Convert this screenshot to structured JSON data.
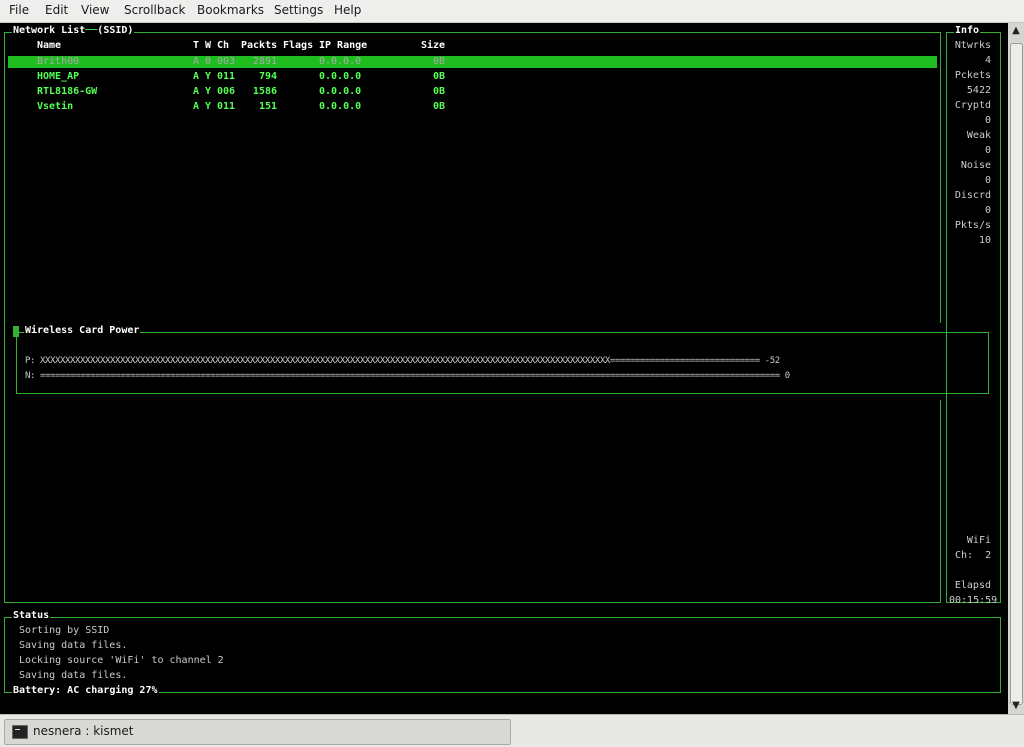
{
  "menubar": {
    "items": [
      "File",
      "Edit",
      "View",
      "Scrollback",
      "Bookmarks",
      "Settings",
      "Help"
    ]
  },
  "network_list": {
    "title": "Network List",
    "sort_label": "(SSID)",
    "headers": {
      "name": "Name",
      "type": "T",
      "wep": "W",
      "channel": "Ch",
      "packets": "Packts",
      "flags": "Flags",
      "ip_range": "IP Range",
      "size": "Size"
    },
    "rows": [
      {
        "name": "Brith00",
        "type": "A",
        "wep": "0",
        "channel": "003",
        "packets": "2891",
        "flags": "",
        "ip_range": "0.0.0.0",
        "size": "0B",
        "selected": true
      },
      {
        "name": "HOME_AP",
        "type": "A",
        "wep": "Y",
        "channel": "011",
        "packets": "794",
        "flags": "",
        "ip_range": "0.0.0.0",
        "size": "0B",
        "selected": false
      },
      {
        "name": "RTL8186-GW",
        "type": "A",
        "wep": "Y",
        "channel": "006",
        "packets": "1586",
        "flags": "",
        "ip_range": "0.0.0.0",
        "size": "0B",
        "selected": false
      },
      {
        "name": "Vsetin",
        "type": "A",
        "wep": "Y",
        "channel": "011",
        "packets": "151",
        "flags": "",
        "ip_range": "0.0.0.0",
        "size": "0B",
        "selected": false
      }
    ]
  },
  "info": {
    "title": "Info",
    "stats": [
      {
        "label": "Ntwrks",
        "value": "4"
      },
      {
        "label": "Pckets",
        "value": "5422"
      },
      {
        "label": "Cryptd",
        "value": "0"
      },
      {
        "label": "Weak",
        "value": "0"
      },
      {
        "label": "Noise",
        "value": "0"
      },
      {
        "label": "Discrd",
        "value": "0"
      },
      {
        "label": "Pkts/s",
        "value": "10"
      }
    ],
    "source_label": "WiFi",
    "channel_text": "Ch:  2",
    "elapsed_label": "Elapsd",
    "elapsed_value": "00:15:59"
  },
  "power": {
    "title": "Wireless Card Power",
    "power_line": "P: XXXXXXXXXXXXXXXXXXXXXXXXXXXXXXXXXXXXXXXXXXXXXXXXXXXXXXXXXXXXXXXXXXXXXXXXXXXXXXXXXXXXXXXXXXXXXXXXXXXXXXXXXXXXXXXXXX============================== -52",
    "noise_line": "N: ==================================================================================================================================================== 0"
  },
  "status": {
    "title": "Status",
    "lines": [
      "Sorting by SSID",
      "Saving data files.",
      "Locking source 'WiFi' to channel 2",
      "Saving data files."
    ],
    "battery": "Battery: AC charging 27%"
  },
  "taskbar": {
    "task_label": "nesnera : kismet"
  },
  "colors": {
    "terminal_bg": "#000000",
    "border_green": "#35b035",
    "text_green": "#55ff55",
    "selection_green": "#1fbd1f"
  }
}
